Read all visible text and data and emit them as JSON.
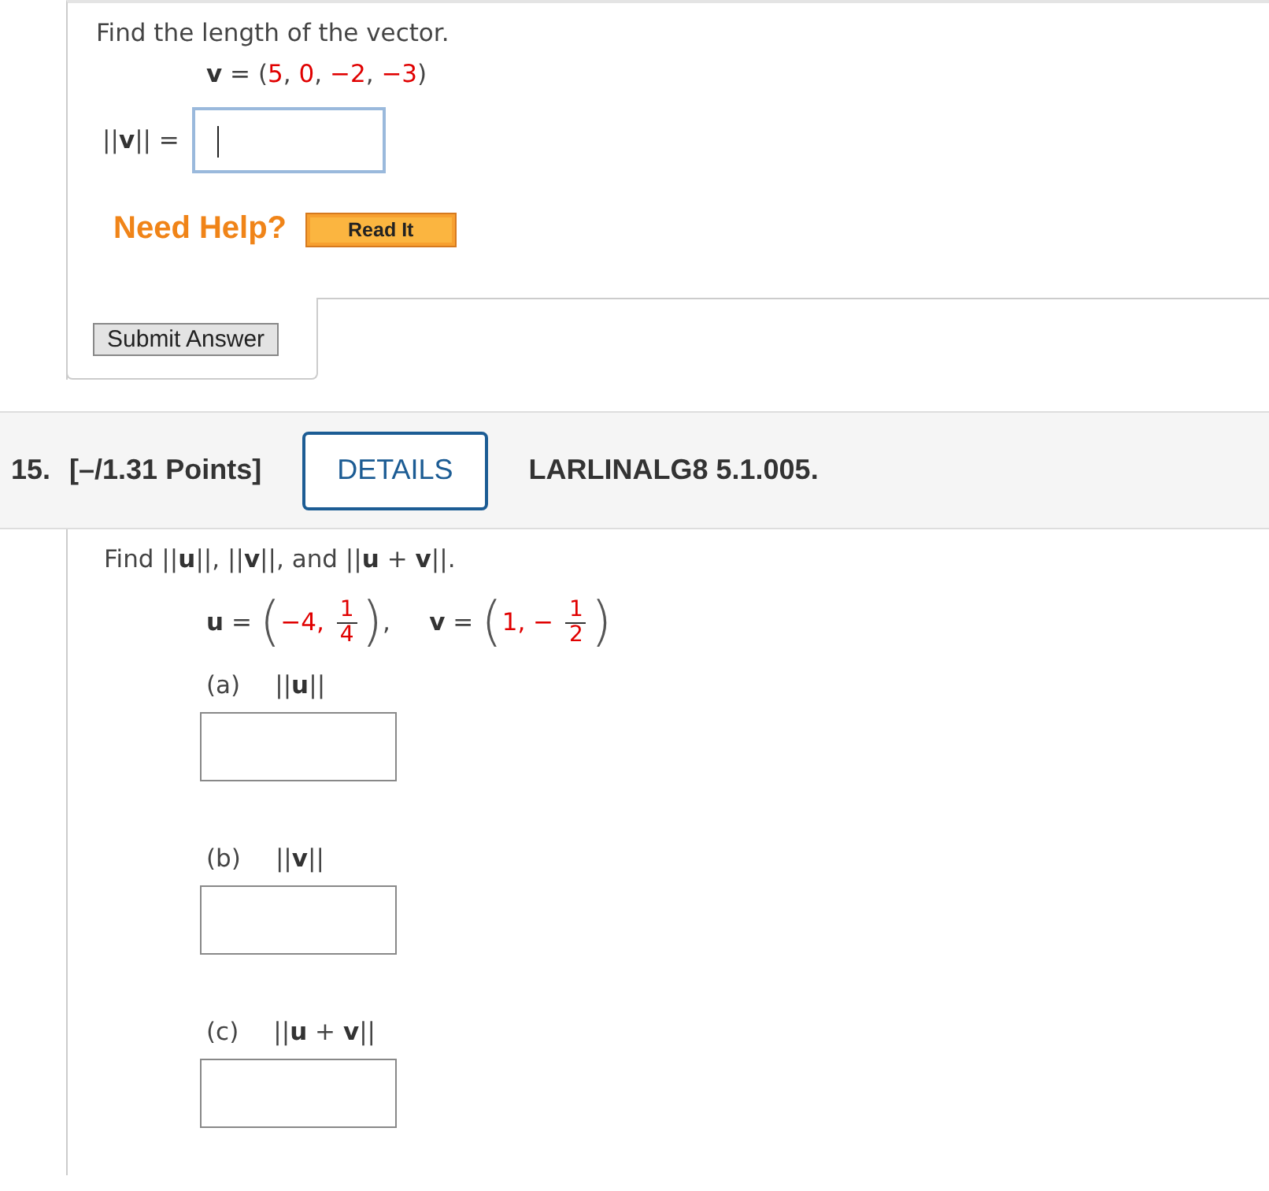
{
  "previous_question": {
    "prompt": "Find the length of the vector.",
    "equation": [
      {
        "kind": "bold",
        "text": "v"
      },
      {
        "kind": "plain",
        "text": " = ("
      },
      {
        "kind": "value",
        "text": "5"
      },
      {
        "kind": "plain",
        "text": ", "
      },
      {
        "kind": "value",
        "text": "0"
      },
      {
        "kind": "plain",
        "text": ", "
      },
      {
        "kind": "value",
        "text": "−2"
      },
      {
        "kind": "plain",
        "text": ", "
      },
      {
        "kind": "value",
        "text": "−3"
      },
      {
        "kind": "plain",
        "text": ")"
      }
    ],
    "answer_label": [
      {
        "kind": "plain",
        "text": "||"
      },
      {
        "kind": "bold",
        "text": "v"
      },
      {
        "kind": "plain",
        "text": "|| ="
      }
    ],
    "answer_field": {
      "focused": true
    },
    "help": {
      "label": "Need Help?",
      "buttons": [
        "Read It"
      ]
    },
    "submit_button": "Submit Answer"
  },
  "question": {
    "number": "15.",
    "points": "[–/1.31 Points]",
    "details_button": "DETAILS",
    "reference": "LARLINALG8 5.1.005.",
    "prompt": [
      {
        "kind": "plain",
        "text": "Find ||"
      },
      {
        "kind": "bold",
        "text": "u"
      },
      {
        "kind": "plain",
        "text": "||, ||"
      },
      {
        "kind": "bold",
        "text": "v"
      },
      {
        "kind": "plain",
        "text": "||, and ||"
      },
      {
        "kind": "bold",
        "text": "u"
      },
      {
        "kind": "plain",
        "text": " + "
      },
      {
        "kind": "bold",
        "text": "v"
      },
      {
        "kind": "plain",
        "text": "||."
      }
    ],
    "equation": [
      {
        "kind": "bold",
        "text": "u"
      },
      {
        "kind": "plain",
        "text": " = "
      },
      {
        "kind": "big",
        "text": "("
      },
      {
        "kind": "value",
        "text": "−4, "
      },
      {
        "kind": "fraction",
        "num": "1",
        "den": "4"
      },
      {
        "kind": "big",
        "text": ")"
      },
      {
        "kind": "plain",
        "text": ",     "
      },
      {
        "kind": "bold",
        "text": "v"
      },
      {
        "kind": "plain",
        "text": " = "
      },
      {
        "kind": "big",
        "text": "("
      },
      {
        "kind": "value",
        "text": "1, − "
      },
      {
        "kind": "fraction",
        "num": "1",
        "den": "2"
      },
      {
        "kind": "big",
        "text": ")"
      }
    ],
    "parts": [
      {
        "label": "(a)",
        "expression": [
          {
            "kind": "plain",
            "text": "||"
          },
          {
            "kind": "bold",
            "text": "u"
          },
          {
            "kind": "plain",
            "text": "||"
          }
        ],
        "answer_field": {
          "focused": false
        }
      },
      {
        "label": "(b)",
        "expression": [
          {
            "kind": "plain",
            "text": "||"
          },
          {
            "kind": "bold",
            "text": "v"
          },
          {
            "kind": "plain",
            "text": "||"
          }
        ],
        "answer_field": {
          "focused": false
        }
      },
      {
        "label": "(c)",
        "expression": [
          {
            "kind": "plain",
            "text": "||"
          },
          {
            "kind": "bold",
            "text": "u"
          },
          {
            "kind": "plain",
            "text": " + "
          },
          {
            "kind": "bold",
            "text": "v"
          },
          {
            "kind": "plain",
            "text": "||"
          }
        ],
        "answer_field": {
          "focused": false
        }
      }
    ]
  }
}
